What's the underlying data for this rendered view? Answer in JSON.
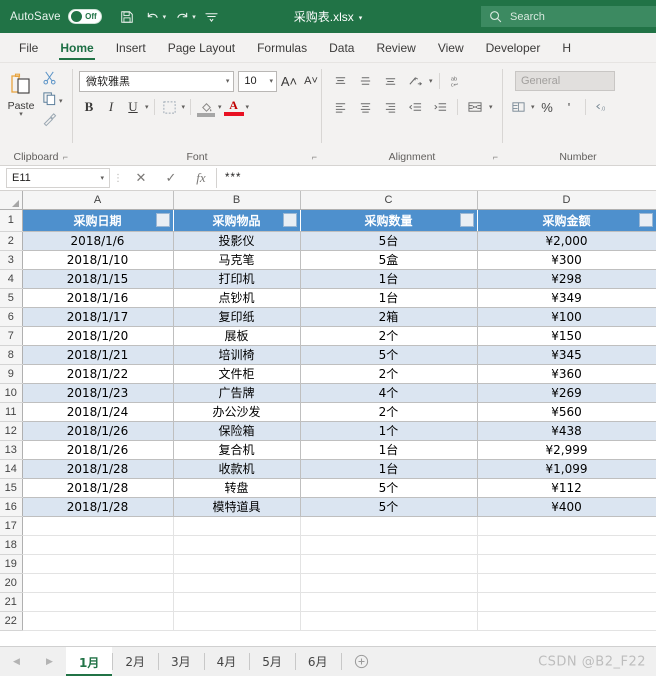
{
  "titlebar": {
    "autosave_label": "AutoSave",
    "autosave_state": "Off",
    "document_title": "采购表.xlsx",
    "icons": [
      "save-icon",
      "undo-icon",
      "redo-icon",
      "customize-quick-access-icon"
    ],
    "search_placeholder": "Search",
    "brand_color": "#217346"
  },
  "ribbon": {
    "tabs": [
      {
        "label": "File"
      },
      {
        "label": "Home"
      },
      {
        "label": "Insert"
      },
      {
        "label": "Page Layout"
      },
      {
        "label": "Formulas"
      },
      {
        "label": "Data"
      },
      {
        "label": "Review"
      },
      {
        "label": "View"
      },
      {
        "label": "Developer"
      },
      {
        "label": "H"
      }
    ],
    "active_tab": "Home",
    "groups": {
      "clipboard": {
        "label": "Clipboard",
        "paste_label": "Paste",
        "buttons": [
          "cut-icon",
          "copy-icon",
          "format-painter-icon"
        ]
      },
      "font": {
        "label": "Font",
        "font_name": "微软雅黑",
        "font_size": "10",
        "bold_label": "B",
        "italic_label": "I",
        "underline_label": "U",
        "font_color_letter": "A",
        "font_color": "#e81123"
      },
      "alignment": {
        "label": "Alignment"
      },
      "number": {
        "label": "Number",
        "format_value": "General",
        "percent_label": "%",
        "comma_label": "'"
      }
    }
  },
  "formula_bar": {
    "name_box": "E11",
    "cancel_icon": "cancel-icon",
    "enter_icon": "confirm-icon",
    "function_icon": "insert-function-icon",
    "formula_value": "***"
  },
  "sheet": {
    "column_letters": [
      "A",
      "B",
      "C",
      "D"
    ],
    "headers": [
      "采购日期",
      "采购物品",
      "采购数量",
      "采购金额"
    ],
    "header_row_number": "1",
    "rows": [
      {
        "n": "2",
        "date": "2018/1/6",
        "item": "投影仪",
        "qty": "5台",
        "amount": "¥2,000"
      },
      {
        "n": "3",
        "date": "2018/1/10",
        "item": "马克笔",
        "qty": "5盒",
        "amount": "¥300"
      },
      {
        "n": "4",
        "date": "2018/1/15",
        "item": "打印机",
        "qty": "1台",
        "amount": "¥298"
      },
      {
        "n": "5",
        "date": "2018/1/16",
        "item": "点钞机",
        "qty": "1台",
        "amount": "¥349"
      },
      {
        "n": "6",
        "date": "2018/1/17",
        "item": "复印纸",
        "qty": "2箱",
        "amount": "¥100"
      },
      {
        "n": "7",
        "date": "2018/1/20",
        "item": "展板",
        "qty": "2个",
        "amount": "¥150"
      },
      {
        "n": "8",
        "date": "2018/1/21",
        "item": "培训椅",
        "qty": "5个",
        "amount": "¥345"
      },
      {
        "n": "9",
        "date": "2018/1/22",
        "item": "文件柜",
        "qty": "2个",
        "amount": "¥360"
      },
      {
        "n": "10",
        "date": "2018/1/23",
        "item": "广告牌",
        "qty": "4个",
        "amount": "¥269"
      },
      {
        "n": "11",
        "date": "2018/1/24",
        "item": "办公沙发",
        "qty": "2个",
        "amount": "¥560"
      },
      {
        "n": "12",
        "date": "2018/1/26",
        "item": "保险箱",
        "qty": "1个",
        "amount": "¥438"
      },
      {
        "n": "13",
        "date": "2018/1/26",
        "item": "复合机",
        "qty": "1台",
        "amount": "¥2,999"
      },
      {
        "n": "14",
        "date": "2018/1/28",
        "item": "收款机",
        "qty": "1台",
        "amount": "¥1,099"
      },
      {
        "n": "15",
        "date": "2018/1/28",
        "item": "转盘",
        "qty": "5个",
        "amount": "¥112"
      },
      {
        "n": "16",
        "date": "2018/1/28",
        "item": "模特道具",
        "qty": "5个",
        "amount": "¥400"
      }
    ],
    "empty_rows": [
      "17",
      "18",
      "19",
      "20",
      "21",
      "22"
    ],
    "header_fill": "#4e90cd",
    "band_fill": "#dbe5f1"
  },
  "tabbar": {
    "sheets": [
      "1月",
      "2月",
      "3月",
      "4月",
      "5月",
      "6月"
    ],
    "active_sheet": "1月",
    "add_sheet_icon": "add-sheet-icon",
    "watermark": "CSDN @B2_F22"
  }
}
